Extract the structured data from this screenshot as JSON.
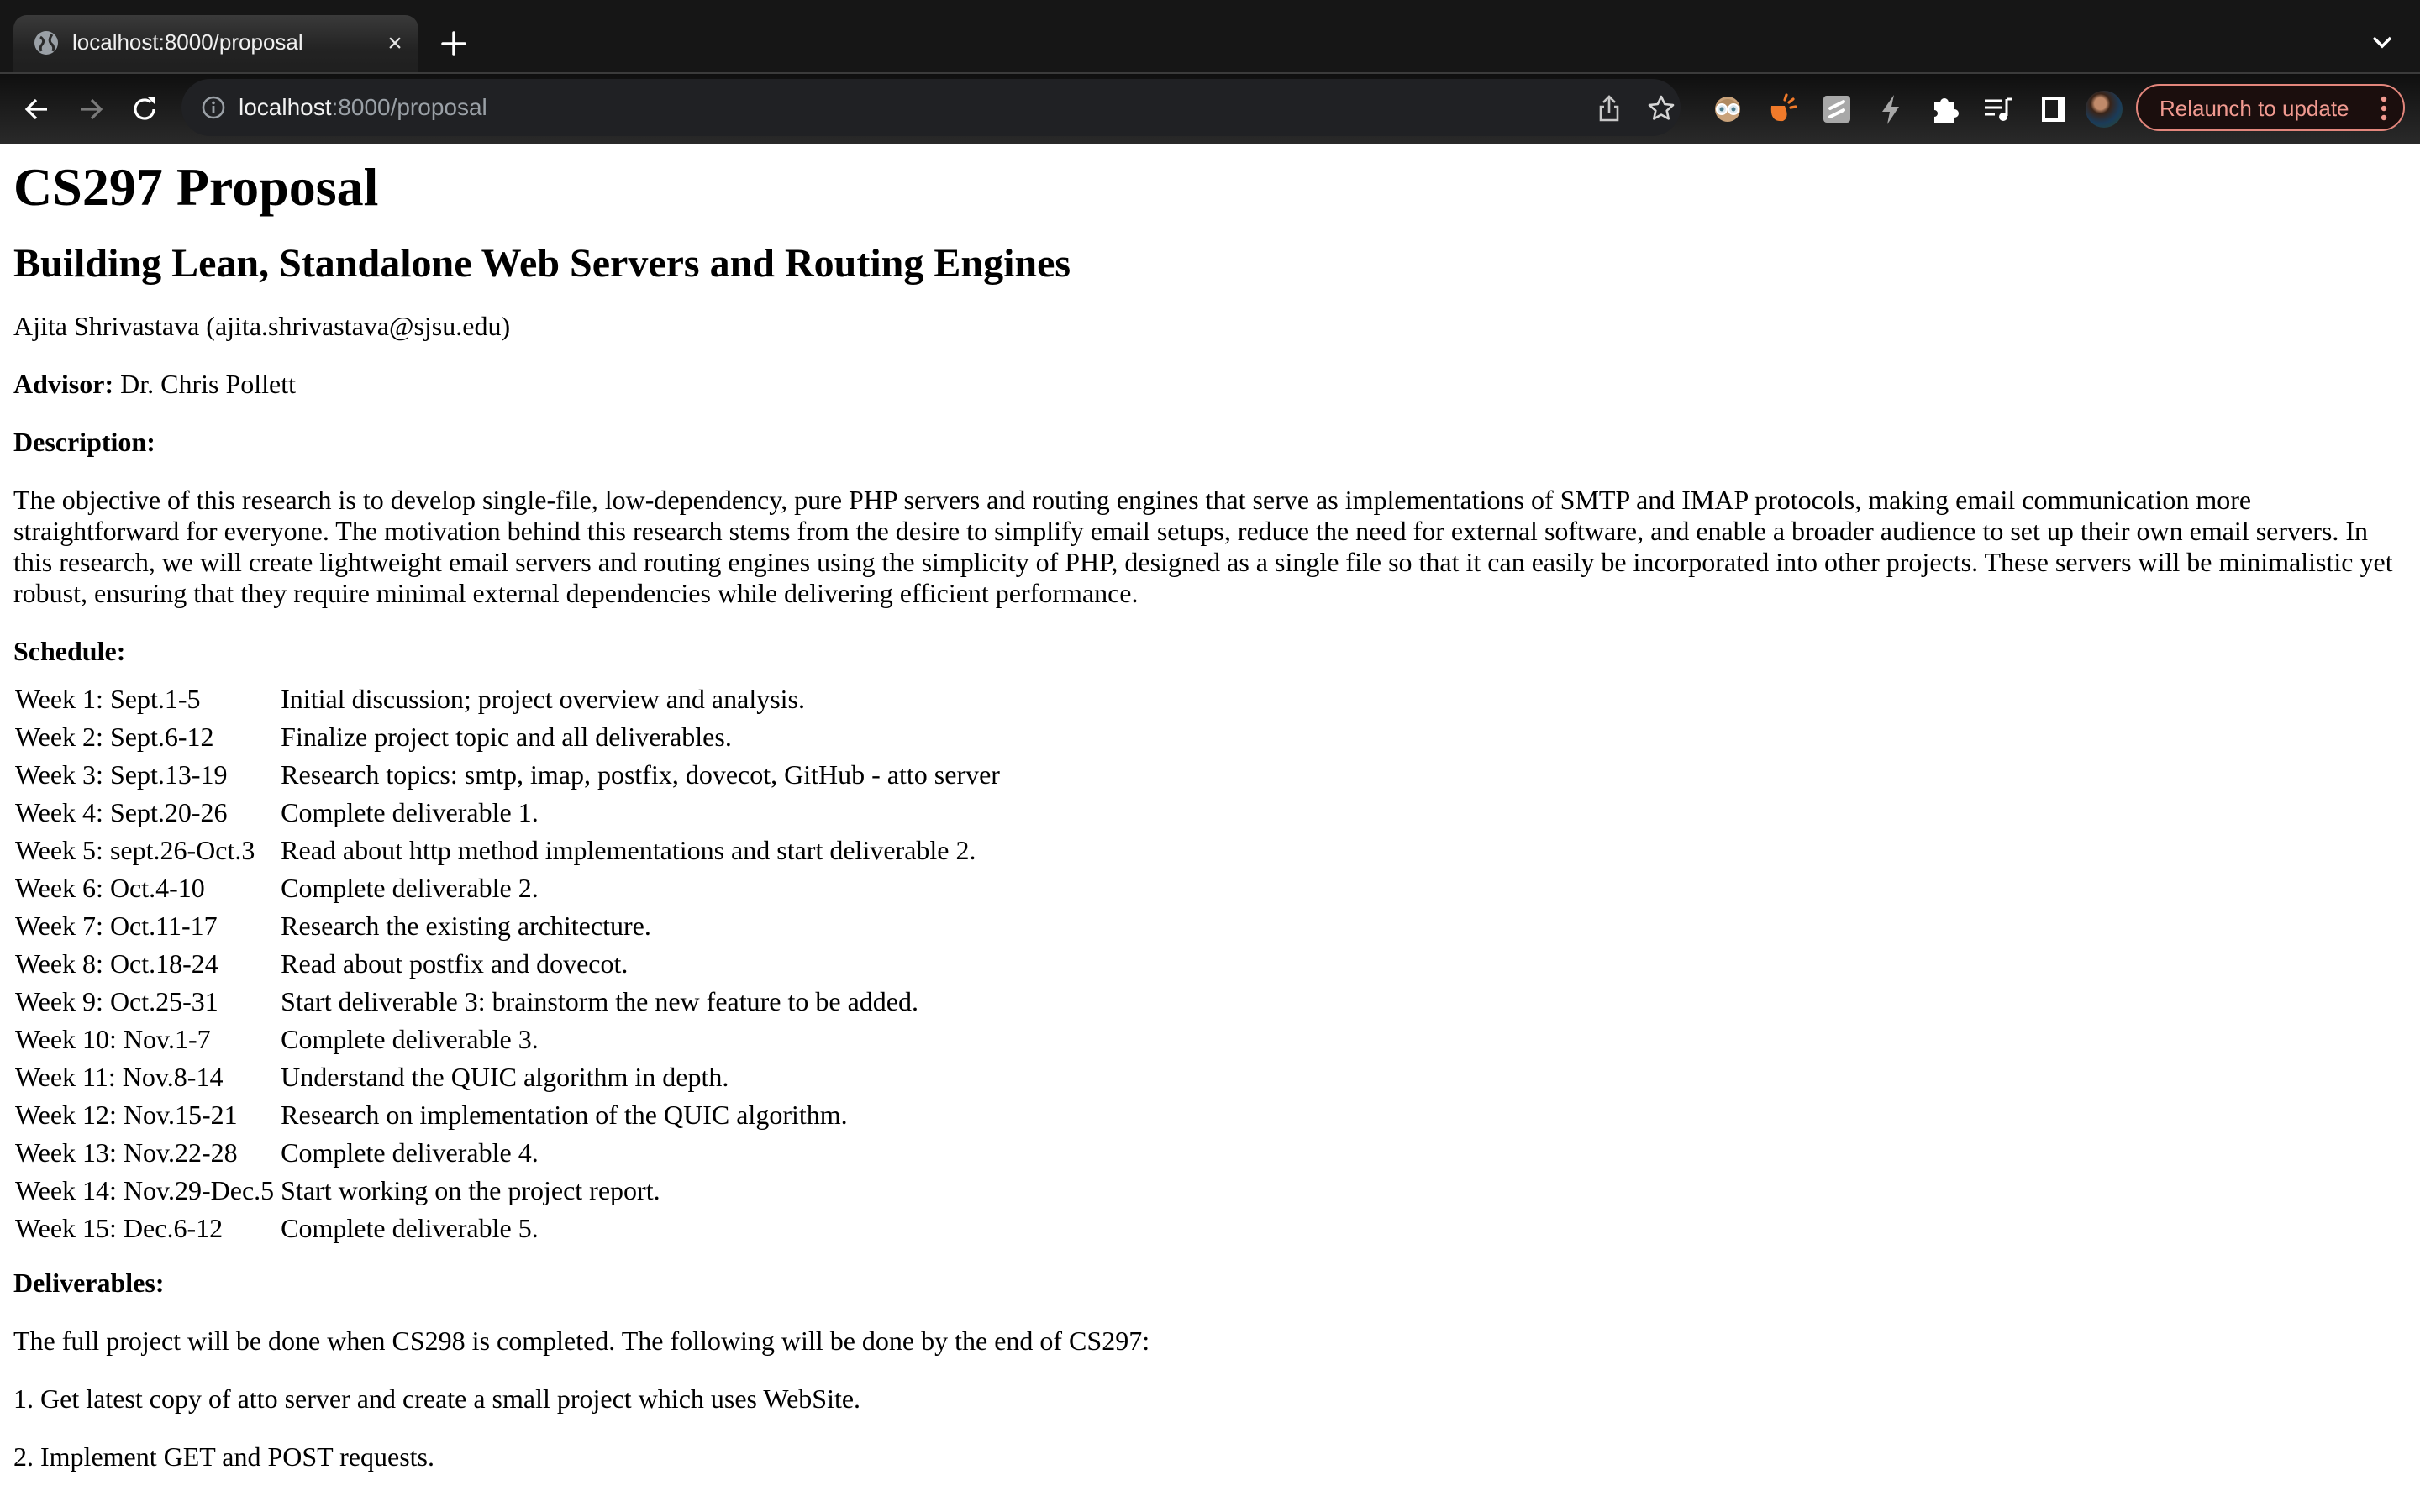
{
  "browser": {
    "tab": {
      "title": "localhost:8000/proposal",
      "close_label": "×",
      "favicon": "globe-icon"
    },
    "new_tab_icon": "plus-icon",
    "tab_list_icon": "chevron-down-icon",
    "toolbar": {
      "back_icon": "arrow-left-icon",
      "forward_icon": "arrow-right-icon",
      "reload_icon": "reload-icon",
      "url_host": "localhost",
      "url_rest": ":8000/proposal",
      "site_info_icon": "info-icon",
      "share_icon": "share-icon",
      "bookmark_icon": "star-icon",
      "extensions": [
        "glasses-avatar-extension-icon",
        "orange-bell-extension-icon",
        "gray-s-extension-icon",
        "lightning-icon",
        "puzzle-icon",
        "media-playlist-icon",
        "side-panel-icon"
      ],
      "profile_icon": "profile-avatar",
      "relaunch_label": "Relaunch to update",
      "menu_icon": "kebab-menu-icon"
    }
  },
  "page": {
    "title": "CS297 Proposal",
    "subtitle": "Building Lean, Standalone Web Servers and Routing Engines",
    "author": "Ajita Shrivastava (ajita.shrivastava@sjsu.edu)",
    "advisor_label": "Advisor:",
    "advisor_name": " Dr. Chris Pollett",
    "description_heading": "Description:",
    "description": "The objective of this research is to develop single-file, low-dependency, pure PHP servers and routing engines that serve as implementations of SMTP and IMAP protocols, making email communication more straightforward for everyone. The motivation behind this research stems from the desire to simplify email setups, reduce the need for external software, and enable a broader audience to set up their own email servers. In this research, we will create lightweight email servers and routing engines using the simplicity of PHP, designed as a single file so that it can easily be incorporated into other projects. These servers will be minimalistic yet robust, ensuring that they require minimal external dependencies while delivering efficient performance.",
    "schedule_heading": "Schedule:",
    "schedule": [
      {
        "week": "Week 1: Sept.1-5",
        "task": "Initial discussion; project overview and analysis."
      },
      {
        "week": "Week 2: Sept.6-12",
        "task": "Finalize project topic and all deliverables."
      },
      {
        "week": "Week 3: Sept.13-19",
        "task": "Research topics: smtp, imap, postfix, dovecot, GitHub - atto server"
      },
      {
        "week": "Week 4: Sept.20-26",
        "task": "Complete deliverable 1."
      },
      {
        "week": "Week 5: sept.26-Oct.3",
        "task": "Read about http method implementations and start deliverable 2."
      },
      {
        "week": "Week 6: Oct.4-10",
        "task": "Complete deliverable 2."
      },
      {
        "week": "Week 7: Oct.11-17",
        "task": "Research the existing architecture."
      },
      {
        "week": "Week 8: Oct.18-24",
        "task": "Read about postfix and dovecot."
      },
      {
        "week": "Week 9: Oct.25-31",
        "task": "Start deliverable 3: brainstorm the new feature to be added."
      },
      {
        "week": "Week 10: Nov.1-7",
        "task": "Complete deliverable 3."
      },
      {
        "week": "Week 11: Nov.8-14",
        "task": "Understand the QUIC algorithm in depth."
      },
      {
        "week": "Week 12: Nov.15-21",
        "task": "Research on implementation of the QUIC algorithm."
      },
      {
        "week": "Week 13: Nov.22-28",
        "task": "Complete deliverable 4."
      },
      {
        "week": "Week 14: Nov.29-Dec.5",
        "task": "Start working on the project report."
      },
      {
        "week": "Week 15: Dec.6-12",
        "task": "Complete deliverable 5."
      }
    ],
    "deliverables_heading": "Deliverables:",
    "deliverables_intro": "The full project will be done when CS298 is completed. The following will be done by the end of CS297:",
    "deliverables": [
      "1. Get latest copy of atto server and create a small project which uses WebSite.",
      "2. Implement GET and POST requests."
    ]
  },
  "colors": {
    "relaunch_accent": "#f19a90",
    "omnibox_bg": "#202124"
  }
}
